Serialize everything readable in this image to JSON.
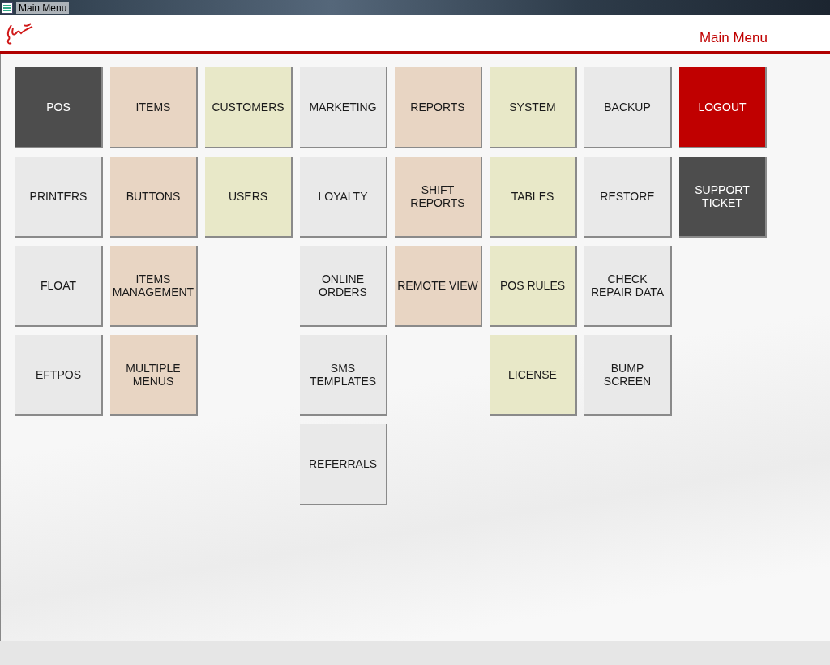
{
  "window": {
    "title": "Main Menu"
  },
  "header": {
    "title": "Main Menu"
  },
  "columns": [
    {
      "buttons": [
        {
          "label": "POS",
          "color": "#4d4d4d"
        },
        {
          "label": "PRINTERS",
          "color": "#e9e9e9"
        },
        {
          "label": "FLOAT",
          "color": "#e9e9e9"
        },
        {
          "label": "EFTPOS",
          "color": "#e9e9e9"
        }
      ]
    },
    {
      "buttons": [
        {
          "label": "ITEMS",
          "color": "#e8d5c3"
        },
        {
          "label": "BUTTONS",
          "color": "#e8d5c3"
        },
        {
          "label": "ITEMS MANAGEMENT",
          "color": "#e8d5c3"
        },
        {
          "label": "MULTIPLE MENUS",
          "color": "#e8d5c3"
        }
      ]
    },
    {
      "buttons": [
        {
          "label": "CUSTOMERS",
          "color": "#e8e8c8"
        },
        {
          "label": "USERS",
          "color": "#e8e8c8"
        }
      ]
    },
    {
      "buttons": [
        {
          "label": "MARKETING",
          "color": "#e9e9e9"
        },
        {
          "label": "LOYALTY",
          "color": "#e9e9e9"
        },
        {
          "label": "ONLINE ORDERS",
          "color": "#e9e9e9"
        },
        {
          "label": "SMS TEMPLATES",
          "color": "#e9e9e9"
        },
        {
          "label": "REFERRALS",
          "color": "#e9e9e9"
        }
      ]
    },
    {
      "buttons": [
        {
          "label": "REPORTS",
          "color": "#e8d5c3"
        },
        {
          "label": "SHIFT REPORTS",
          "color": "#e8d5c3"
        },
        {
          "label": "REMOTE VIEW",
          "color": "#e8d5c3"
        }
      ]
    },
    {
      "buttons": [
        {
          "label": "SYSTEM",
          "color": "#e8e8c8"
        },
        {
          "label": "TABLES",
          "color": "#e8e8c8"
        },
        {
          "label": "POS RULES",
          "color": "#e8e8c8"
        },
        {
          "label": "LICENSE",
          "color": "#e8e8c8"
        }
      ]
    },
    {
      "buttons": [
        {
          "label": "BACKUP",
          "color": "#e9e9e9"
        },
        {
          "label": "RESTORE",
          "color": "#e9e9e9"
        },
        {
          "label": "CHECK REPAIR DATA",
          "color": "#e9e9e9"
        },
        {
          "label": "BUMP SCREEN",
          "color": "#e9e9e9"
        }
      ]
    },
    {
      "buttons": [
        {
          "label": "LOGOUT",
          "color": "#c00000"
        },
        {
          "label": "SUPPORT TICKET",
          "color": "#4d4d4d"
        }
      ]
    }
  ]
}
